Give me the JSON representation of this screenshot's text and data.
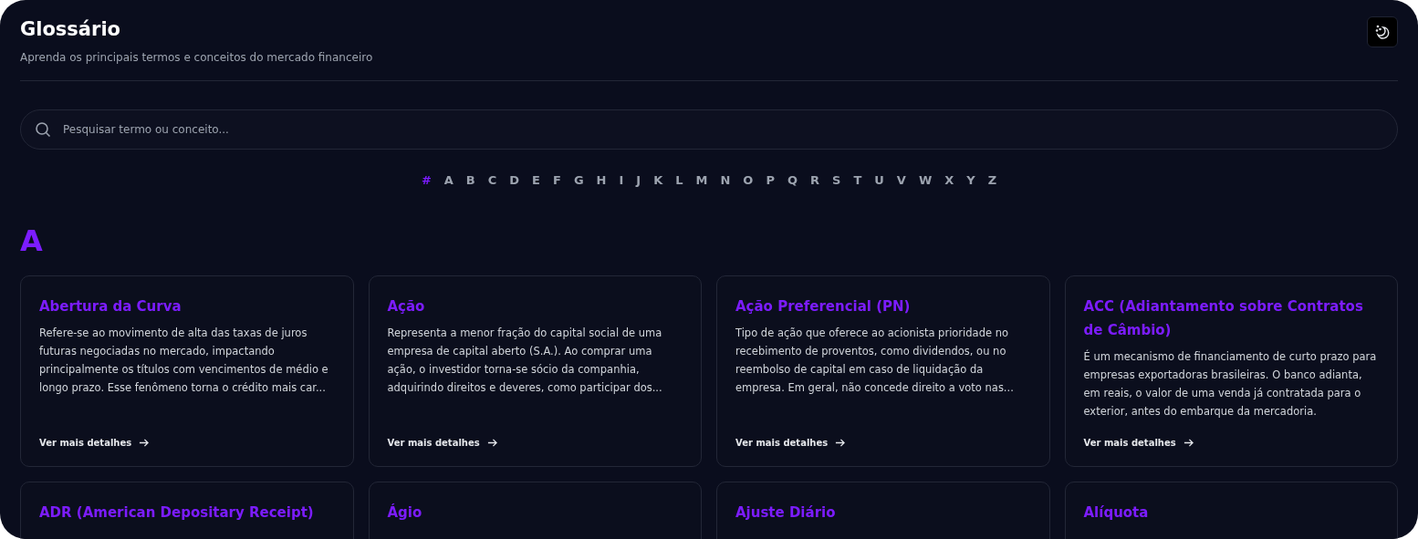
{
  "header": {
    "title": "Glossário",
    "subtitle": "Aprenda os principais termos e conceitos do mercado financeiro"
  },
  "search": {
    "placeholder": "Pesquisar termo ou conceito..."
  },
  "letters": [
    {
      "label": "#",
      "selected": true
    },
    {
      "label": "A",
      "selected": false
    },
    {
      "label": "B",
      "selected": false
    },
    {
      "label": "C",
      "selected": false
    },
    {
      "label": "D",
      "selected": false
    },
    {
      "label": "E",
      "selected": false
    },
    {
      "label": "F",
      "selected": false
    },
    {
      "label": "G",
      "selected": false
    },
    {
      "label": "H",
      "selected": false
    },
    {
      "label": "I",
      "selected": false
    },
    {
      "label": "J",
      "selected": false
    },
    {
      "label": "K",
      "selected": false
    },
    {
      "label": "L",
      "selected": false
    },
    {
      "label": "M",
      "selected": false
    },
    {
      "label": "N",
      "selected": false
    },
    {
      "label": "O",
      "selected": false
    },
    {
      "label": "P",
      "selected": false
    },
    {
      "label": "Q",
      "selected": false
    },
    {
      "label": "R",
      "selected": false
    },
    {
      "label": "S",
      "selected": false
    },
    {
      "label": "T",
      "selected": false
    },
    {
      "label": "U",
      "selected": false
    },
    {
      "label": "V",
      "selected": false
    },
    {
      "label": "W",
      "selected": false
    },
    {
      "label": "X",
      "selected": false
    },
    {
      "label": "Y",
      "selected": false
    },
    {
      "label": "Z",
      "selected": false
    }
  ],
  "section": {
    "letter": "A",
    "terms": [
      {
        "title": "Abertura da Curva",
        "description": "Refere-se ao movimento de alta das taxas de juros futuras negociadas no mercado, impactando principalmente os títulos com vencimentos de médio e longo prazo. Esse fenômeno torna o crédito mais car...",
        "link": "Ver mais detalhes"
      },
      {
        "title": "Ação",
        "description": "Representa a menor fração do capital social de uma empresa de capital aberto (S.A.). Ao comprar uma ação, o investidor torna-se sócio da companhia, adquirindo direitos e deveres, como participar dos...",
        "link": "Ver mais detalhes"
      },
      {
        "title": "Ação Preferencial (PN)",
        "description": "Tipo de ação que oferece ao acionista prioridade no recebimento de proventos, como dividendos, ou no reembolso de capital em caso de liquidação da empresa. Em geral, não concede direito a voto nas...",
        "link": "Ver mais detalhes"
      },
      {
        "title": "ACC (Adiantamento sobre Contratos de Câmbio)",
        "description": "É um mecanismo de financiamento de curto prazo para empresas exportadoras brasileiras. O banco adianta, em reais, o valor de uma venda já contratada para o exterior, antes do embarque da mercadoria.",
        "link": "Ver mais detalhes"
      },
      {
        "title": "ADR (American Depositary Receipt)"
      },
      {
        "title": "Ágio"
      },
      {
        "title": "Ajuste Diário"
      },
      {
        "title": "Alíquota"
      }
    ]
  }
}
